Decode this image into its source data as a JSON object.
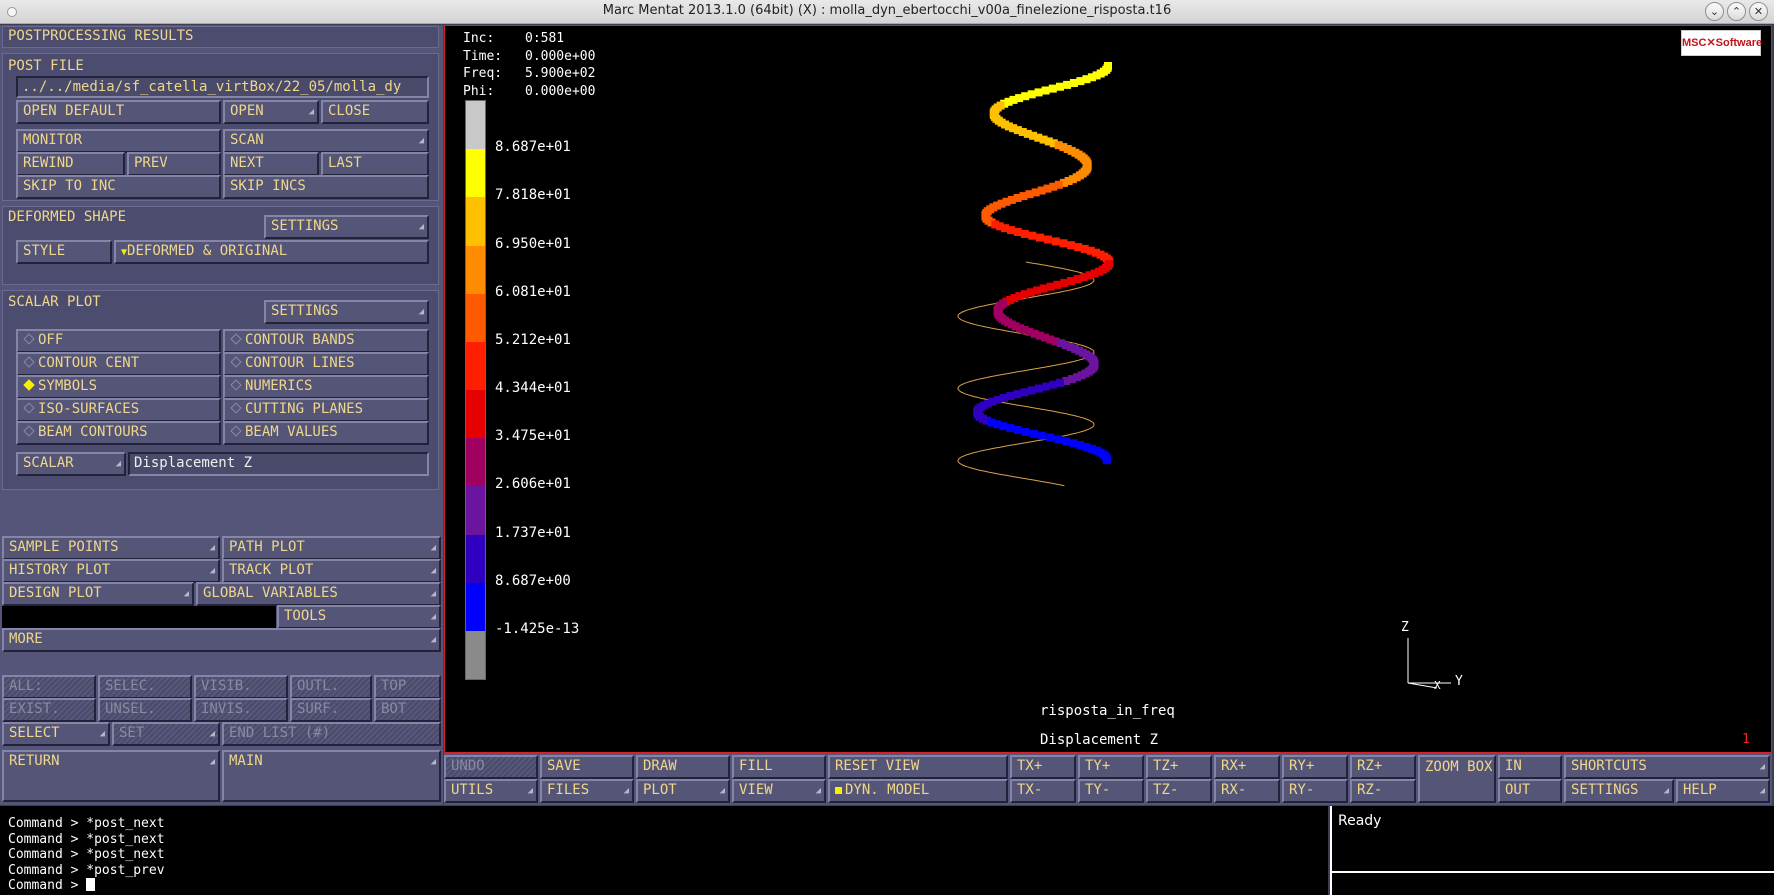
{
  "window": {
    "title": "Marc Mentat 2013.1.0 (64bit) (X) : molla_dyn_ebertocchi_v00a_finelezione_risposta.t16",
    "minimize": "⌄",
    "maximize": "⌃",
    "close": "✕"
  },
  "left": {
    "header": "POSTPROCESSING RESULTS",
    "post_file": {
      "label": "POST FILE",
      "path": "../../media/sf_catella_virtBox/22_05/molla_dy",
      "open_default": "OPEN DEFAULT",
      "open": "OPEN",
      "close": "CLOSE",
      "monitor": "MONITOR",
      "scan": "SCAN",
      "rewind": "REWIND",
      "prev": "PREV",
      "next": "NEXT",
      "last": "LAST",
      "skip_to_inc": "SKIP TO INC",
      "skip_incs": "SKIP INCS"
    },
    "deformed": {
      "label": "DEFORMED SHAPE",
      "settings": "SETTINGS",
      "style": "STYLE",
      "style_value": "DEFORMED & ORIGINAL"
    },
    "scalar": {
      "label": "SCALAR PLOT",
      "settings": "SETTINGS",
      "off": "OFF",
      "contour_bands": "CONTOUR BANDS",
      "contour_cent": "CONTOUR CENT",
      "contour_lines": "CONTOUR LINES",
      "symbols": "SYMBOLS",
      "numerics": "NUMERICS",
      "iso_surfaces": "ISO-SURFACES",
      "cutting_planes": "CUTTING PLANES",
      "beam_contours": "BEAM CONTOURS",
      "beam_values": "BEAM VALUES",
      "scalar": "SCALAR",
      "scalar_value": "Displacement Z"
    },
    "plots": {
      "sample_points": "SAMPLE POINTS",
      "path_plot": "PATH PLOT",
      "history_plot": "HISTORY PLOT",
      "track_plot": "TRACK PLOT",
      "design_plot": "DESIGN PLOT",
      "global_variables": "GLOBAL VARIABLES",
      "tools": "TOOLS",
      "more": "MORE"
    },
    "sel": {
      "all": "ALL:",
      "selec": "SELEC.",
      "visib": "VISIB.",
      "outl": "OUTL.",
      "top": "TOP",
      "exist": "EXIST.",
      "unsel": "UNSEL.",
      "invis": "INVIS.",
      "surf": "SURF.",
      "bot": "BOT",
      "select": "SELECT",
      "set": "SET",
      "end_list": "END LIST (#)"
    },
    "return": "RETURN",
    "main": "MAIN"
  },
  "viewport": {
    "info": {
      "inc_k": "Inc:",
      "inc_v": "0:581",
      "time_k": "Time:",
      "time_v": "0.000e+00",
      "freq_k": "Freq:",
      "freq_v": "5.900e+02",
      "phi_k": "Phi:",
      "phi_v": "0.000e+00"
    },
    "legend": [
      "8.687e+01",
      "7.818e+01",
      "6.950e+01",
      "6.081e+01",
      "5.212e+01",
      "4.344e+01",
      "3.475e+01",
      "2.606e+01",
      "1.737e+01",
      "8.687e+00",
      "-1.425e-13"
    ],
    "legend_colors": [
      "#c8c8c8",
      "#ffff00",
      "#ffc000",
      "#ff8c00",
      "#ff5a00",
      "#ff1e00",
      "#e60000",
      "#a00060",
      "#6a14a0",
      "#3000c0",
      "#0000ff",
      "#8a8a8a"
    ],
    "logo": "MSC✕Software",
    "job": "risposta_in_freq",
    "scalar": "Displacement Z",
    "count": "1",
    "axes": {
      "z": "Z",
      "y": "Y",
      "x": "X"
    }
  },
  "bottom": {
    "undo": "UNDO",
    "save": "SAVE",
    "draw": "DRAW",
    "fill": "FILL",
    "reset_view": "RESET VIEW",
    "txp": "TX+",
    "typ": "TY+",
    "tzp": "TZ+",
    "rxp": "RX+",
    "ryp": "RY+",
    "rzp": "RZ+",
    "zoom_box": "ZOOM BOX",
    "in": "IN",
    "shortcuts": "SHORTCUTS",
    "utils": "UTILS",
    "files": "FILES",
    "plot": "PLOT",
    "view": "VIEW",
    "dyn_model": "DYN. MODEL",
    "txm": "TX-",
    "tym": "TY-",
    "tzm": "TZ-",
    "rxm": "RX-",
    "rym": "RY-",
    "rzm": "RZ-",
    "out": "OUT",
    "settings": "SETTINGS",
    "help": "HELP"
  },
  "command": {
    "lines": [
      "Command > *post_next",
      "Command > *post_next",
      "Command > *post_next",
      "Command > *post_prev"
    ],
    "prompt": "Command > "
  },
  "status": "Ready"
}
